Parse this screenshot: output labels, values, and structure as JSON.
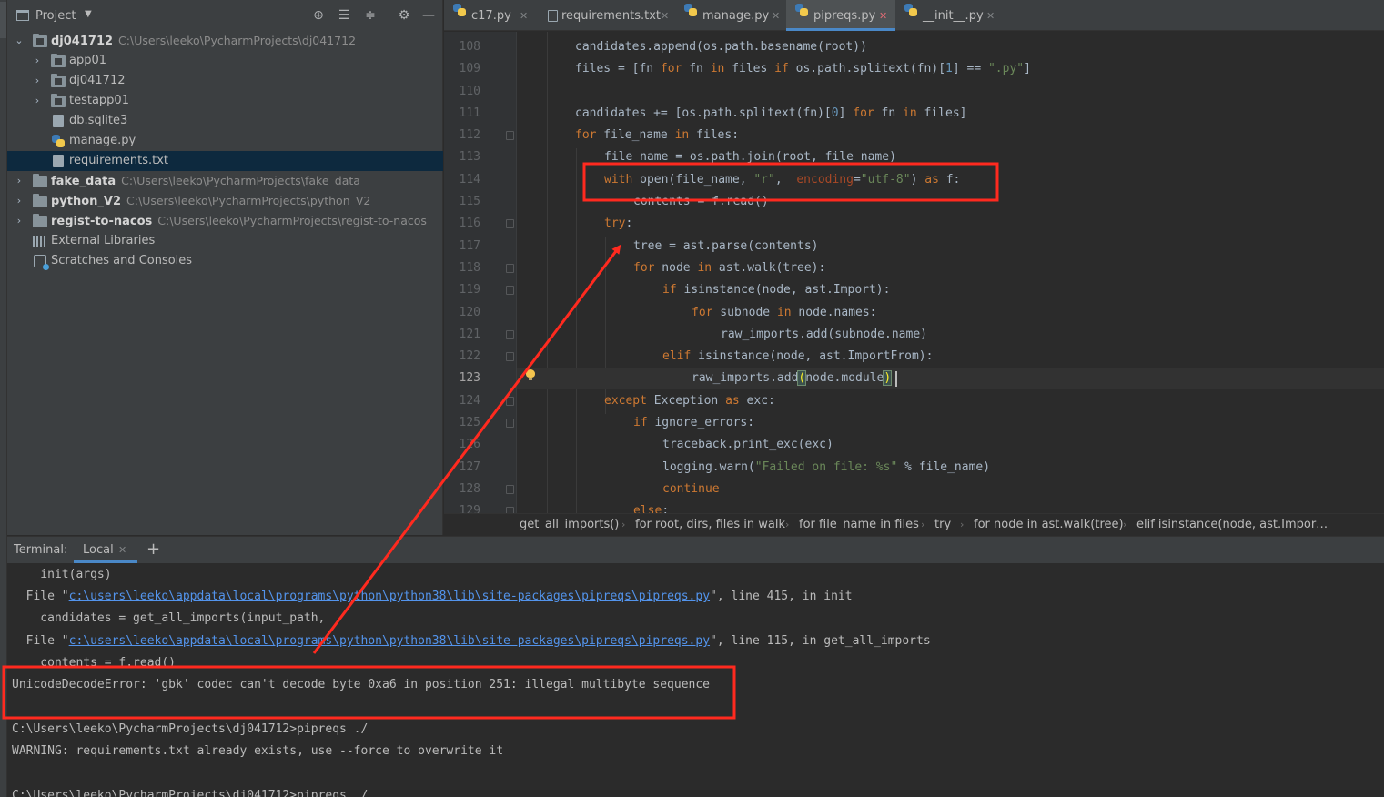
{
  "project_panel": {
    "title": "Project",
    "tree": [
      {
        "label": "dj041712",
        "path": "C:\\Users\\leeko\\PycharmProjects\\dj041712"
      },
      {
        "label": "app01"
      },
      {
        "label": "dj041712"
      },
      {
        "label": "testapp01"
      },
      {
        "label": "db.sqlite3"
      },
      {
        "label": "manage.py"
      },
      {
        "label": "requirements.txt"
      },
      {
        "label": "fake_data",
        "path": "C:\\Users\\leeko\\PycharmProjects\\fake_data"
      },
      {
        "label": "python_V2",
        "path": "C:\\Users\\leeko\\PycharmProjects\\python_V2"
      },
      {
        "label": "regist-to-nacos",
        "path": "C:\\Users\\leeko\\PycharmProjects\\regist-to-nacos"
      },
      {
        "label": "External Libraries"
      },
      {
        "label": "Scratches and Consoles"
      }
    ]
  },
  "tabs": [
    {
      "label": "c17.py"
    },
    {
      "label": "requirements.txt"
    },
    {
      "label": "manage.py"
    },
    {
      "label": "pipreqs.py"
    },
    {
      "label": "__init__.py"
    }
  ],
  "editor": {
    "line_numbers": [
      "108",
      "109",
      "110",
      "111",
      "112",
      "113",
      "114",
      "115",
      "116",
      "117",
      "118",
      "119",
      "120",
      "121",
      "122",
      "123",
      "124",
      "125",
      "126",
      "127",
      "128",
      "129"
    ],
    "current_line": "123",
    "code": {
      "l108": [
        "candidates.append(os.path.basename(root))"
      ],
      "l109": [
        "files = [fn ",
        "for",
        " fn ",
        "in",
        " files ",
        "if",
        " os.path.splitext(fn)[",
        "1",
        "] == ",
        "\".py\"",
        "]"
      ],
      "l111": [
        "candidates += [os.path.splitext(fn)[",
        "0",
        "] ",
        "for",
        " fn ",
        "in",
        " files]"
      ],
      "l112": [
        "for",
        " file_name ",
        "in",
        " files:"
      ],
      "l113": [
        "file_name = os.path.join(root, file_name)"
      ],
      "l114": [
        "with",
        " open(file_name, ",
        "\"r\"",
        ",  ",
        "encoding",
        "=",
        "\"utf-8\"",
        ") ",
        "as",
        " f:"
      ],
      "l115": [
        "contents = f.read()"
      ],
      "l116": [
        "try",
        ":"
      ],
      "l117": [
        "tree = ast.parse(contents)"
      ],
      "l118": [
        "for",
        " node ",
        "in",
        " ast.walk(tree):"
      ],
      "l119": [
        "if",
        " isinstance(node, ast.Import):"
      ],
      "l120": [
        "for",
        " subnode ",
        "in",
        " node.names:"
      ],
      "l121": [
        "raw_imports.add(subnode.name)"
      ],
      "l122": [
        "elif",
        " isinstance(node, ast.ImportFrom):"
      ],
      "l123": [
        "raw_imports.add",
        "(",
        "node.module",
        ")"
      ],
      "l124": [
        "except",
        " Exception ",
        "as",
        " exc:"
      ],
      "l125": [
        "if",
        " ignore_errors:"
      ],
      "l126": [
        "traceback.print_exc(exc)"
      ],
      "l127": [
        "logging.warn(",
        "\"Failed on file: %s\"",
        " % file_name)"
      ],
      "l128": [
        "continue"
      ],
      "l129": [
        "else",
        ":"
      ]
    }
  },
  "breadcrumb": [
    "get_all_imports()",
    "for root, dirs, files in walk",
    "for file_name in files",
    "try",
    "for node in ast.walk(tree)",
    "elif isinstance(node, ast.Impor…"
  ],
  "terminal": {
    "label": "Terminal:",
    "tab": "Local",
    "lines": {
      "t1": "    init(args)",
      "t2_pre": "  File \"",
      "t2_link": "c:\\users\\leeko\\appdata\\local\\programs\\python\\python38\\lib\\site-packages\\pipreqs\\pipreqs.py",
      "t2_post": "\", line 415, in init",
      "t3": "    candidates = get_all_imports(input_path,",
      "t4_pre": "  File \"",
      "t4_link": "c:\\users\\leeko\\appdata\\local\\programs\\python\\python38\\lib\\site-packages\\pipreqs\\pipreqs.py",
      "t4_post": "\", line 115, in get_all_imports",
      "t5": "    contents = f.read()",
      "t6": "UnicodeDecodeError: 'gbk' codec can't decode byte 0xa6 in position 251: illegal multibyte sequence",
      "t7": "",
      "t8": "C:\\Users\\leeko\\PycharmProjects\\dj041712>pipreqs ./",
      "t9": "WARNING: requirements.txt already exists, use --force to overwrite it",
      "t10": "",
      "t11": "C:\\Users\\leeko\\PycharmProjects\\dj041712>pipreqs ./"
    }
  },
  "colors": {
    "annotation_red": "#ff2a1f",
    "keyword": "#cc7832",
    "string": "#6a8759",
    "number": "#6897bb",
    "link": "#5394ec"
  }
}
